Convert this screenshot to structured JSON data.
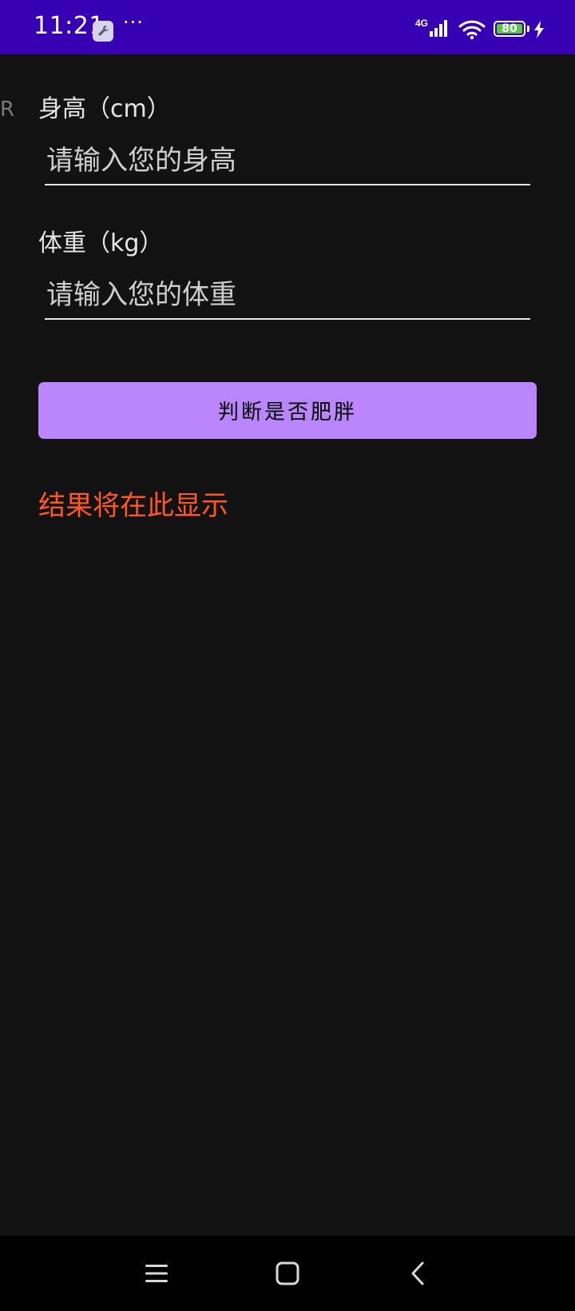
{
  "status_bar": {
    "time": "11:21",
    "more": "···",
    "network": "4G",
    "battery_level": "80",
    "colors": {
      "background": "#3700B3",
      "battery_fill": "#58c74a"
    },
    "icons": [
      "debug-wrench-icon",
      "more-icon",
      "signal-4g-icon",
      "wifi-icon",
      "battery-icon",
      "charging-bolt-icon"
    ]
  },
  "form": {
    "edge_letter": "R",
    "height": {
      "label": "身高（cm）",
      "placeholder": "请输入您的身高",
      "value": ""
    },
    "weight": {
      "label": "体重（kg）",
      "placeholder": "请输入您的体重",
      "value": ""
    },
    "submit_label": "判断是否肥胖",
    "result_text": "结果将在此显示",
    "colors": {
      "background": "#121212",
      "button": "#BB86FC",
      "result": "#FF5722"
    }
  },
  "nav_bar": {
    "icons": [
      "menu-icon",
      "home-icon",
      "back-icon"
    ]
  }
}
